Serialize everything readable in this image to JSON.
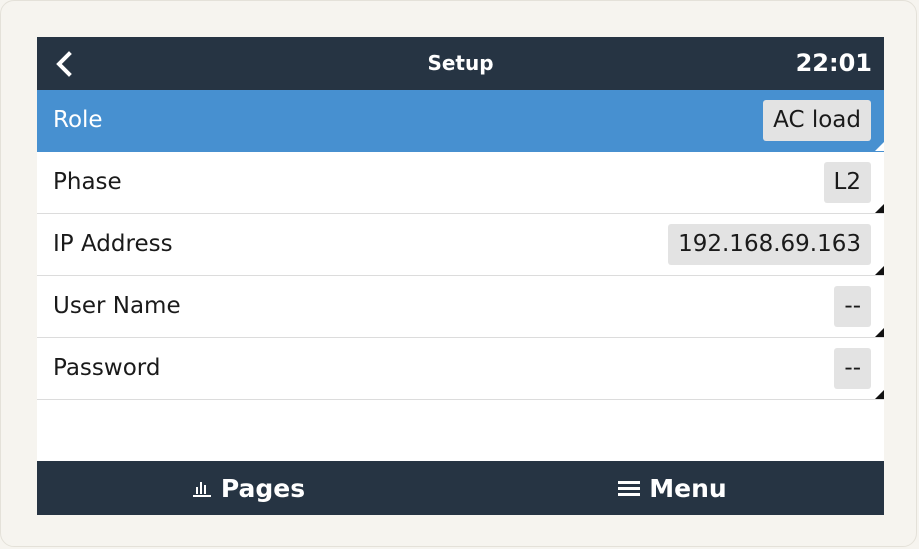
{
  "header": {
    "back_icon": "chevron-left-icon",
    "title": "Setup",
    "time": "22:01"
  },
  "settings": [
    {
      "label": "Role",
      "value": "AC load",
      "selected": true
    },
    {
      "label": "Phase",
      "value": "L2",
      "selected": false
    },
    {
      "label": "IP Address",
      "value": "192.168.69.163",
      "selected": false
    },
    {
      "label": "User Name",
      "value": "--",
      "selected": false
    },
    {
      "label": "Password",
      "value": "--",
      "selected": false
    }
  ],
  "footer": {
    "pages_label": "Pages",
    "pages_icon": "bar-chart-icon",
    "menu_label": "Menu",
    "menu_icon": "hamburger-menu-icon"
  },
  "colors": {
    "header_bg": "#263443",
    "selected_row": "#4790d0",
    "value_box": "#e3e3e3",
    "page_bg": "#f6f4ef"
  }
}
